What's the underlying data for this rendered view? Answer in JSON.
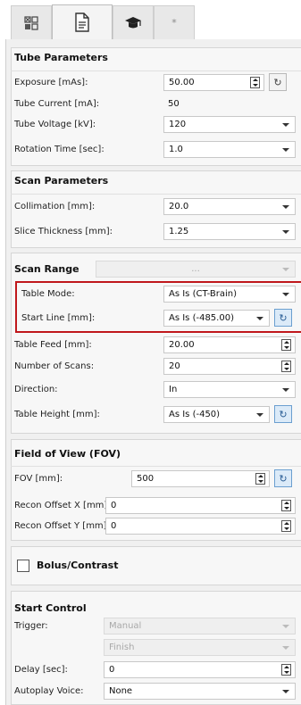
{
  "tabs": [
    {
      "icon": "grid-icon",
      "active": false
    },
    {
      "icon": "document-icon",
      "active": true
    },
    {
      "icon": "graduation-cap-icon",
      "active": false
    },
    {
      "label": "*",
      "active": false
    }
  ],
  "tube": {
    "title": "Tube Parameters",
    "exposure_label": "Exposure [mAs]:",
    "exposure_value": "50.00",
    "current_label": "Tube Current [mA]:",
    "current_value": "50",
    "voltage_label": "Tube Voltage [kV]:",
    "voltage_value": "120",
    "rotation_label": "Rotation Time [sec]:",
    "rotation_value": "1.0"
  },
  "scan_params": {
    "title": "Scan Parameters",
    "collimation_label": "Collimation [mm]:",
    "collimation_value": "20.0",
    "slice_label": "Slice Thickness [mm]:",
    "slice_value": "1.25"
  },
  "scan_range": {
    "title": "Scan Range",
    "bar_value": "...",
    "table_mode_label": "Table Mode:",
    "table_mode_value": "As Is (CT-Brain)",
    "start_line_label": "Start Line [mm]:",
    "start_line_value": "As Is (-485.00)",
    "table_feed_label": "Table Feed [mm]:",
    "table_feed_value": "20.00",
    "num_scans_label": "Number of Scans:",
    "num_scans_value": "20",
    "direction_label": "Direction:",
    "direction_value": "In",
    "table_height_label": "Table Height [mm]:",
    "table_height_value": "As Is (-450)"
  },
  "fov": {
    "title": "Field of View (FOV)",
    "fov_label": "FOV [mm]:",
    "fov_value": "500",
    "offset_x_label": "Recon Offset X [mm]:",
    "offset_x_value": "0",
    "offset_y_label": "Recon Offset Y [mm]:",
    "offset_y_value": "0"
  },
  "bolus": {
    "label": "Bolus/Contrast",
    "checked": false
  },
  "start_control": {
    "title": "Start Control",
    "trigger_label": "Trigger:",
    "trigger_value": "Manual",
    "finish_value": "Finish",
    "delay_label": "Delay [sec]:",
    "delay_value": "0",
    "voice_label": "Autoplay Voice:",
    "voice_value": "None"
  },
  "colors": {
    "highlight": "#c0171b",
    "reset_accent": "#6b9fd0"
  }
}
